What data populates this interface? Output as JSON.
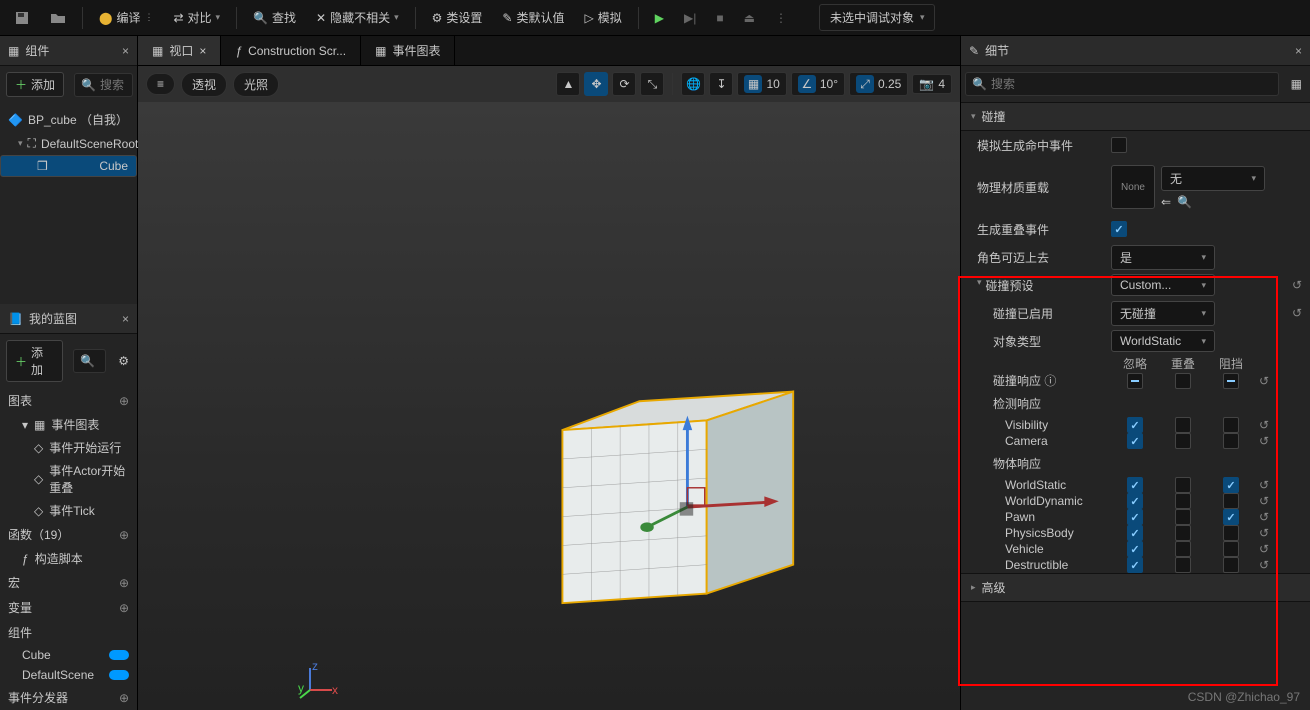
{
  "toolbar": {
    "compile": "编译",
    "diff": "对比",
    "find": "查找",
    "hide": "隐藏不相关",
    "class_settings": "类设置",
    "class_defaults": "类默认值",
    "simulate": "模拟",
    "debug_object": "未选中调试对象"
  },
  "panels": {
    "components": "组件",
    "my_blueprint": "我的蓝图",
    "details": "细节",
    "add": "添加",
    "search": "搜索"
  },
  "tree": {
    "root": "BP_cube （自我）",
    "scene": "DefaultSceneRoot",
    "cube": "Cube"
  },
  "tabs": {
    "viewport": "视口",
    "construction": "Construction Scr...",
    "event_graph": "事件图表"
  },
  "vp": {
    "menu": "≡",
    "persp": "透视",
    "lit": "光照",
    "snap_g": "10",
    "snap_r": "10°",
    "snap_s": "0.25",
    "cam": "4"
  },
  "bp": {
    "graphs": "图表",
    "event_graph": "事件图表",
    "begin_play": "事件开始运行",
    "actor_overlap": "事件Actor开始重叠",
    "tick": "事件Tick",
    "functions": "函数（19）",
    "construction_script": "构造脚本",
    "macros": "宏",
    "variables": "变量",
    "cube_var": "Cube",
    "default_scene_var": "DefaultScene",
    "dispatchers": "事件分发器"
  },
  "details": {
    "cat_collision": "碰撞",
    "sim_hit": "模拟生成命中事件",
    "phys_mat": "物理材质重载",
    "thumb_none": "None",
    "sel_none": "无",
    "gen_overlap": "生成重叠事件",
    "can_step": "角色可迈上去",
    "can_step_val": "是",
    "preset": "碰撞预设",
    "preset_val": "Custom...",
    "enabled": "碰撞已启用",
    "enabled_val": "无碰撞",
    "obj_type": "对象类型",
    "obj_type_val": "WorldStatic",
    "hdr_ignore": "忽略",
    "hdr_overlap": "重叠",
    "hdr_block": "阻挡",
    "resp": "碰撞响应",
    "trace": "检测响应",
    "obj": "物体响应",
    "channels": [
      "Visibility",
      "Camera"
    ],
    "obj_channels": [
      "WorldStatic",
      "WorldDynamic",
      "Pawn",
      "PhysicsBody",
      "Vehicle",
      "Destructible"
    ],
    "responses": {
      "Visibility": [
        true,
        false,
        false
      ],
      "Camera": [
        true,
        false,
        false
      ],
      "WorldStatic": [
        true,
        false,
        true
      ],
      "WorldDynamic": [
        true,
        false,
        false
      ],
      "Pawn": [
        true,
        false,
        true
      ],
      "PhysicsBody": [
        true,
        false,
        false
      ],
      "Vehicle": [
        true,
        false,
        false
      ],
      "Destructible": [
        true,
        false,
        false
      ]
    },
    "advanced": "高级"
  },
  "watermark": "CSDN @Zhichao_97"
}
